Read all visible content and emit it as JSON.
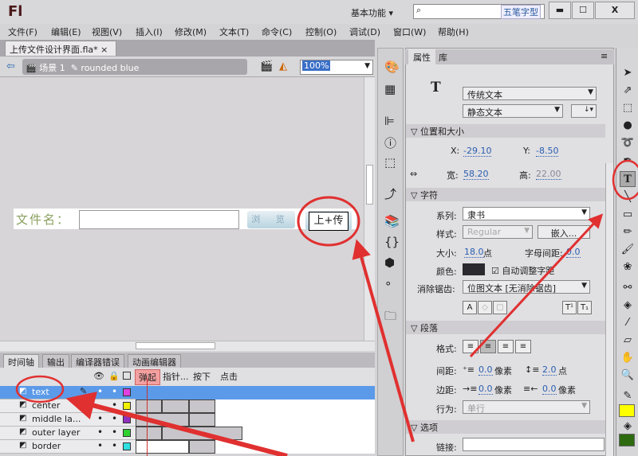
{
  "app": {
    "logo": "Fl",
    "workspace": "基本功能",
    "ime": "五笔字型",
    "win_min": "▬",
    "win_max": "☐",
    "win_close": "X"
  },
  "menu": [
    "文件(F)",
    "编辑(E)",
    "视图(V)",
    "插入(I)",
    "修改(M)",
    "文本(T)",
    "命令(C)",
    "控制(O)",
    "调试(D)",
    "窗口(W)",
    "帮助(H)"
  ],
  "document": {
    "tab": "上传文件设计界面.fla*",
    "close": "×",
    "scene": "场景 1",
    "symbol": "rounded blue",
    "zoom": "100%"
  },
  "stage": {
    "file_label": "文件名：",
    "browse": "浏 览",
    "upload": "上+传"
  },
  "timeline": {
    "tabs": [
      "时间轴",
      "输出",
      "编译器错误",
      "动画编辑器"
    ],
    "frames": [
      "弹起",
      "指针...",
      "按下",
      "点击"
    ],
    "layers": [
      {
        "name": "text",
        "color": "#e040e0",
        "selected": true
      },
      {
        "name": "center",
        "color": "#f0f000"
      },
      {
        "name": "middle la...",
        "color": "#9030c0"
      },
      {
        "name": "outer layer",
        "color": "#30d030"
      },
      {
        "name": "border",
        "color": "#30e0e0"
      }
    ]
  },
  "properties": {
    "tabs": [
      "属性",
      "库"
    ],
    "type_icon": "T",
    "text_engine": "传统文本",
    "text_type": "静态文本",
    "pos_section": "位置和大小",
    "x_label": "X:",
    "x": "-29.10",
    "y_label": "Y:",
    "y": "-8.50",
    "w_label": "宽:",
    "w": "58.20",
    "h_label": "高:",
    "h": "22.00",
    "char_section": "字符",
    "family_label": "系列:",
    "family": "隶书",
    "style_label": "样式:",
    "style": "Regular",
    "embed": "嵌入...",
    "size_label": "大小:",
    "size": "18.0",
    "size_unit": "点",
    "spacing_label": "字母间距:",
    "spacing": "0.0",
    "color_label": "颜色:",
    "text_color": "#2a2a2e",
    "autokern": "自动调整字距",
    "aa_label": "消除锯齿:",
    "aa": "位图文本 [无消除锯齿]",
    "para_section": "段落",
    "format_label": "格式:",
    "gap_label": "间距:",
    "indent": "0.0",
    "px": "像素",
    "line_spacing": "2.0",
    "pt": "点",
    "margin_label": "边距:",
    "margin_left": "0.0",
    "margin_right": "0.0",
    "behavior_label": "行为:",
    "behavior": "单行",
    "options_section": "选项",
    "link_label": "链接:"
  },
  "tools": {
    "stroke_color": "#ffff00",
    "fill_color": "#2e6a10"
  },
  "annotation_color": "#e03030"
}
